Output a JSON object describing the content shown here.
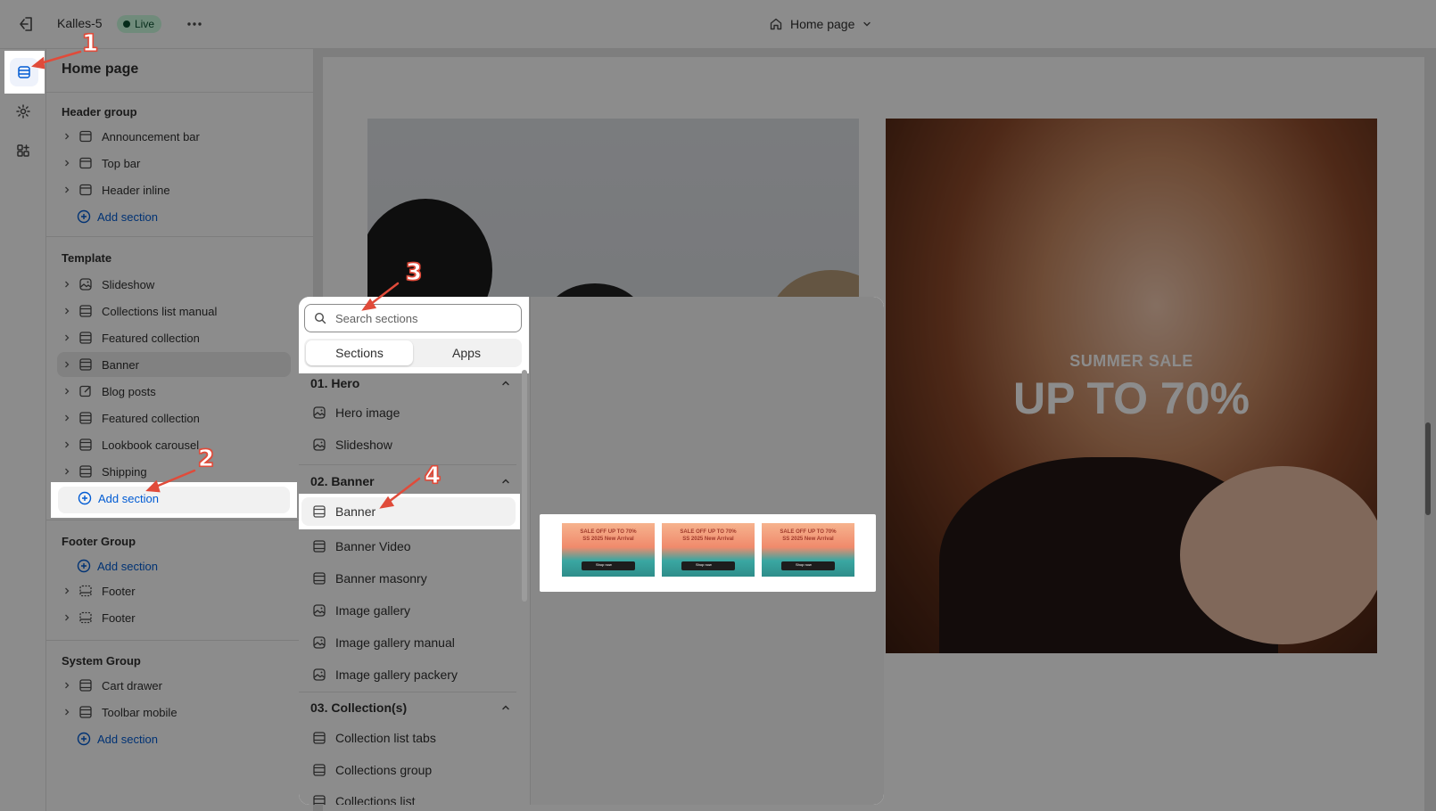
{
  "topbar": {
    "store_name": "Kalles-5",
    "status_badge": "Live",
    "page_selector": "Home page"
  },
  "sidebar": {
    "title": "Home page",
    "groups": {
      "header": {
        "title": "Header group",
        "items": [
          "Announcement bar",
          "Top bar",
          "Header inline"
        ],
        "add_label": "Add section"
      },
      "template": {
        "title": "Template",
        "items": [
          "Slideshow",
          "Collections list manual",
          "Featured collection",
          "Banner",
          "Blog posts",
          "Featured collection",
          "Lookbook carousel",
          "Shipping"
        ],
        "add_label": "Add section"
      },
      "footer": {
        "title": "Footer Group",
        "add_label": "Add section",
        "items": [
          "Footer",
          "Footer"
        ]
      },
      "system": {
        "title": "System Group",
        "items": [
          "Cart drawer",
          "Toolbar mobile"
        ],
        "add_label": "Add section"
      }
    }
  },
  "preview": {
    "sale_small": "SUMMER SALE",
    "sale_big": "UP TO 70%"
  },
  "picker": {
    "search": {
      "placeholder": "Search sections",
      "value": ""
    },
    "tabs": [
      "Sections",
      "Apps"
    ],
    "categories": [
      {
        "title": "01. Hero",
        "items": [
          "Hero image",
          "Slideshow"
        ]
      },
      {
        "title": "02. Banner",
        "items": [
          "Banner",
          "Banner Video",
          "Banner masonry",
          "Image gallery",
          "Image gallery manual",
          "Image gallery packery"
        ]
      },
      {
        "title": "03. Collection(s)",
        "items": [
          "Collection list tabs",
          "Collections group",
          "Collections list"
        ]
      }
    ],
    "thumbnails": [
      {
        "headline": "SALE OFF UP TO 70%",
        "sub": "SS 2025 New Arrival",
        "button": "Shop now"
      },
      {
        "headline": "SALE OFF UP TO 70%",
        "sub": "SS 2025 New Arrival",
        "button": "Shop now"
      },
      {
        "headline": "SALE OFF UP TO 70%",
        "sub": "SS 2025 New Arrival",
        "button": "Shop now"
      }
    ]
  },
  "callouts": [
    "1",
    "2",
    "3",
    "4"
  ],
  "colors": {
    "accent": "#005bd3",
    "live_bg": "#cdfee1",
    "callout": "#e04b3a"
  }
}
